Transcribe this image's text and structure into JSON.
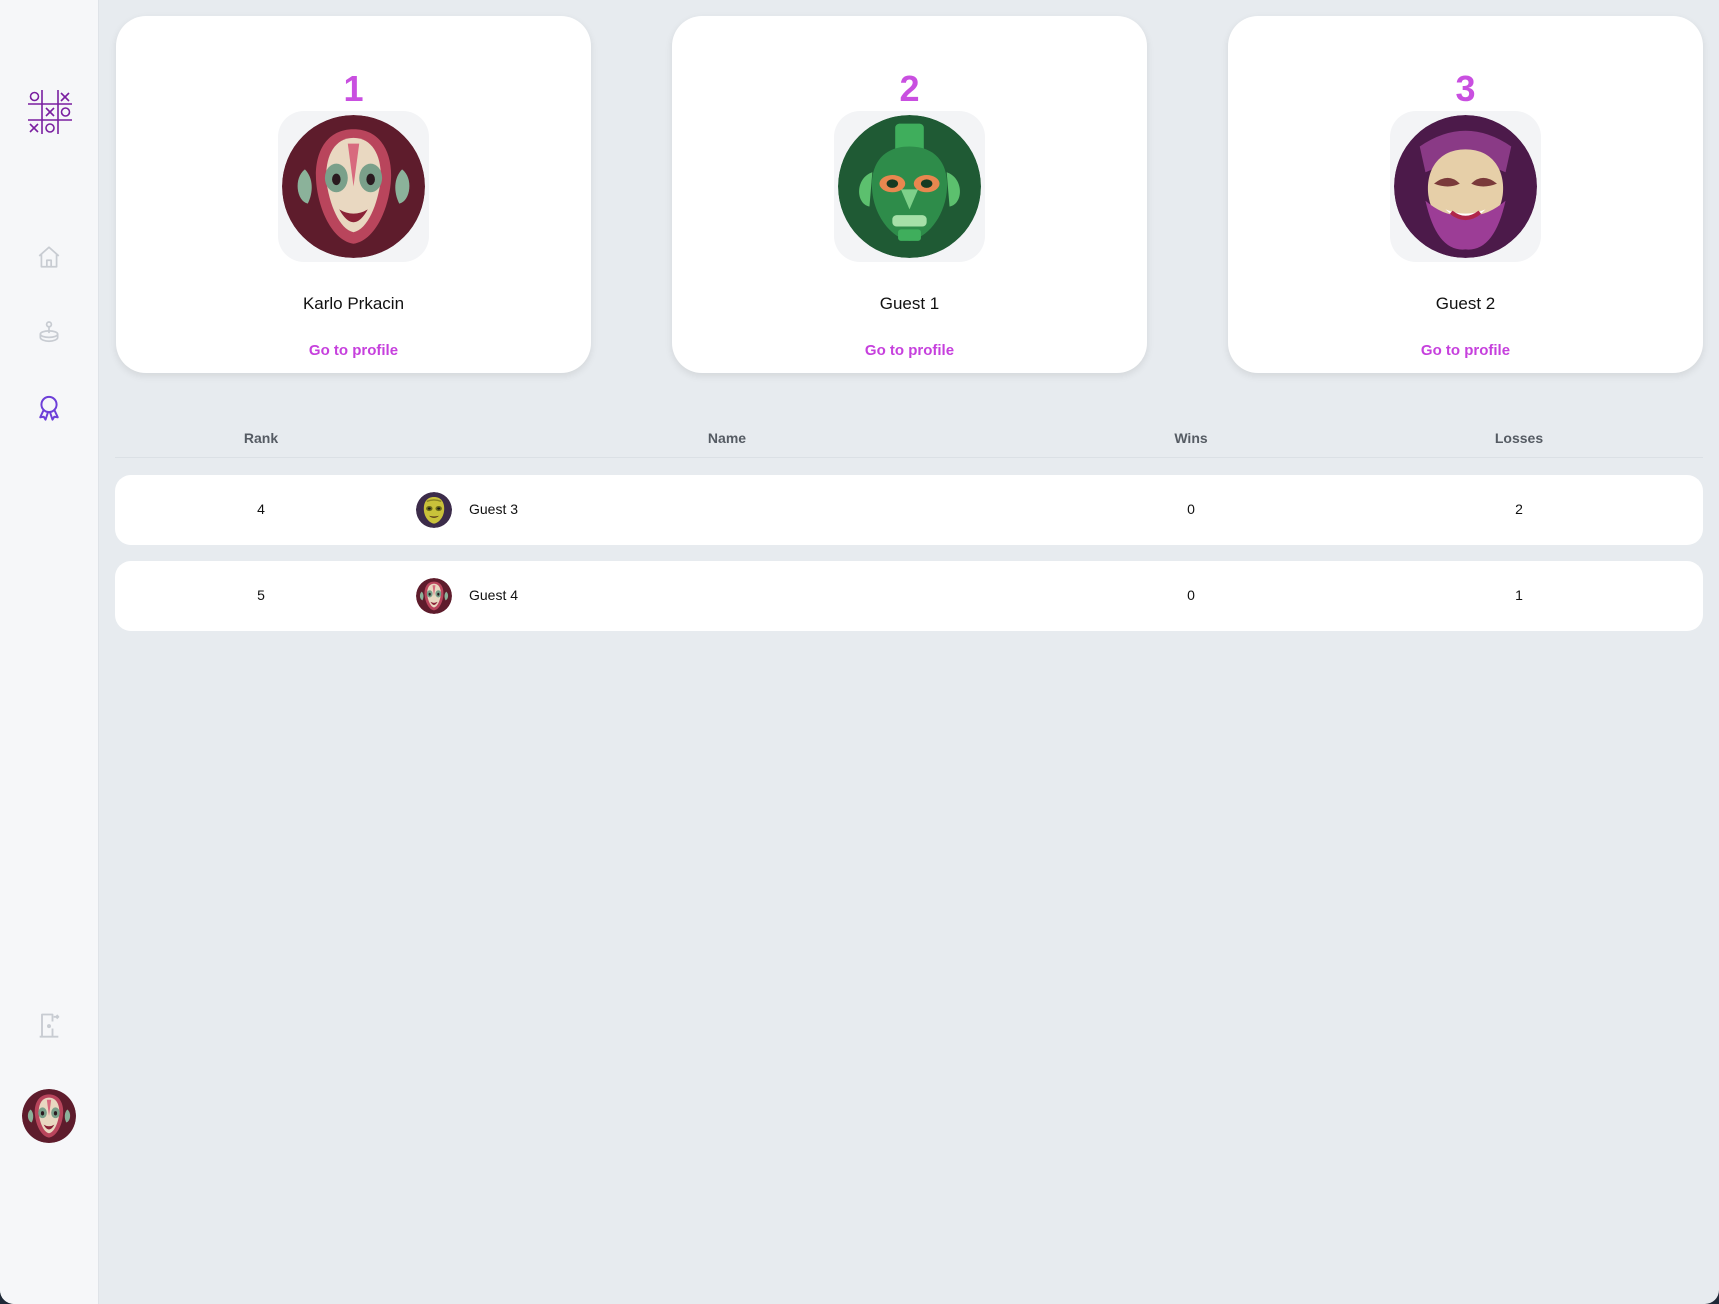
{
  "sidebar": {
    "logo_icon": "tic-tac-toe-logo-icon",
    "nav": [
      {
        "icon": "home-icon",
        "active": false
      },
      {
        "icon": "joystick-icon",
        "active": false
      },
      {
        "icon": "award-ribbon-icon",
        "active": true
      },
      {
        "icon": "logout-door-icon",
        "active": false
      }
    ],
    "user_avatar": "tribal-mask-avatar-red"
  },
  "colors": {
    "accent": "#c94fe0",
    "link": "#c640dd",
    "active_nav": "#6d3fd8",
    "inactive_nav": "#c8ccd2",
    "background": "#e7ebef",
    "card": "#ffffff"
  },
  "podium": [
    {
      "rank": "1",
      "name": "Karlo Prkacin",
      "link": "Go to profile",
      "avatar": "tribal-mask-red"
    },
    {
      "rank": "2",
      "name": "Guest 1",
      "link": "Go to profile",
      "avatar": "tribal-mask-green"
    },
    {
      "rank": "3",
      "name": "Guest 2",
      "link": "Go to profile",
      "avatar": "tribal-mask-purple"
    }
  ],
  "table": {
    "headers": {
      "rank": "Rank",
      "name": "Name",
      "wins": "Wins",
      "losses": "Losses"
    },
    "rows": [
      {
        "rank": "4",
        "name": "Guest 3",
        "wins": "0",
        "losses": "2",
        "avatar": "tribal-mask-yellow"
      },
      {
        "rank": "5",
        "name": "Guest 4",
        "wins": "0",
        "losses": "1",
        "avatar": "tribal-mask-red"
      }
    ]
  }
}
